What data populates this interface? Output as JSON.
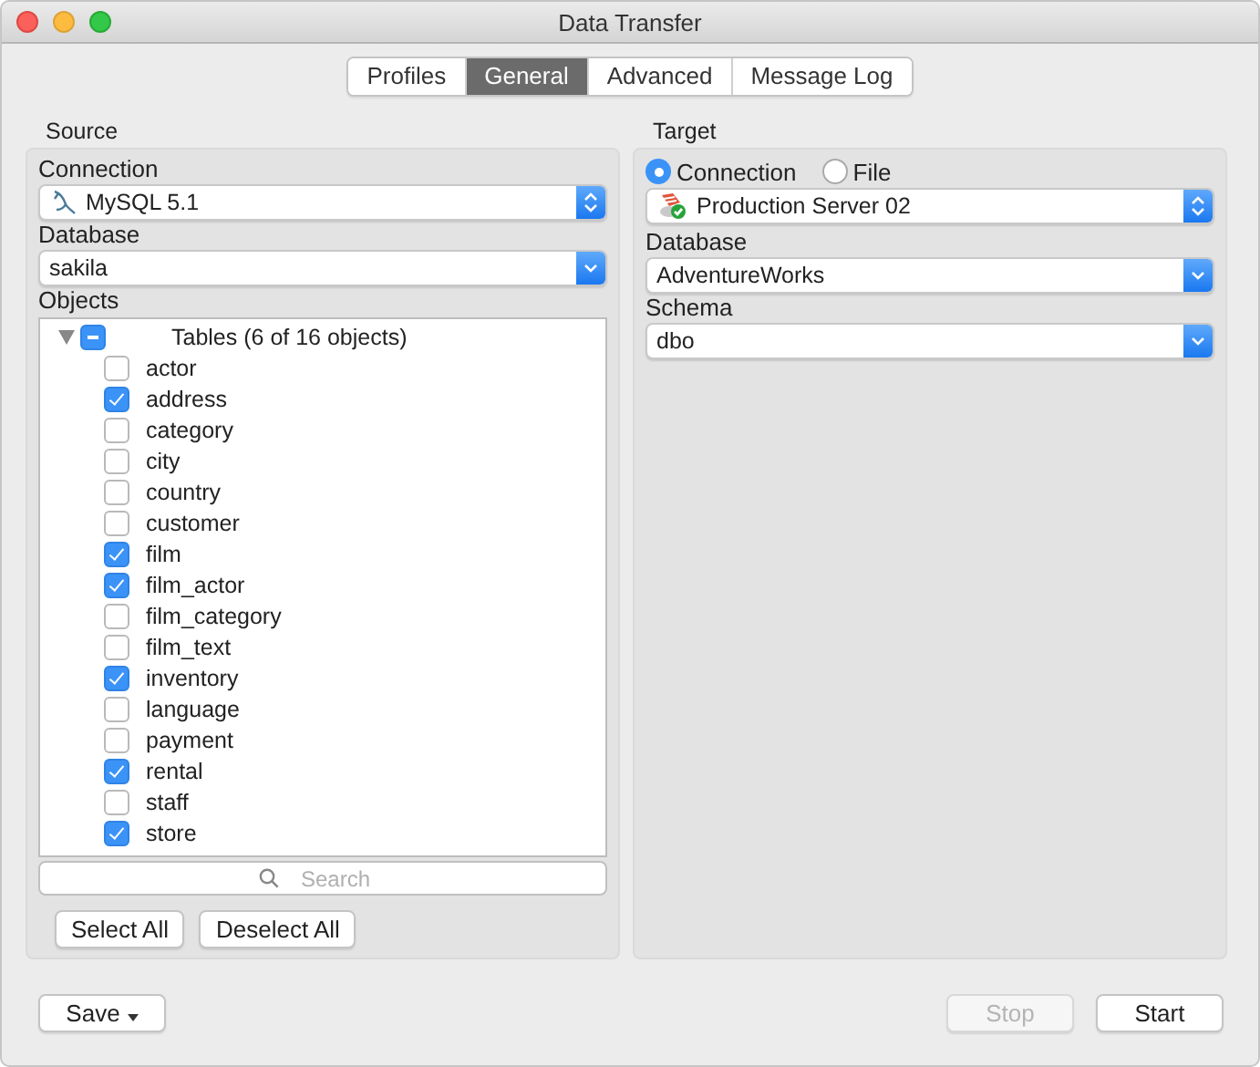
{
  "window": {
    "title": "Data Transfer"
  },
  "tabs": [
    {
      "label": "Profiles",
      "selected": false
    },
    {
      "label": "General",
      "selected": true
    },
    {
      "label": "Advanced",
      "selected": false
    },
    {
      "label": "Message Log",
      "selected": false
    }
  ],
  "source": {
    "heading": "Source",
    "connection_label": "Connection",
    "connection": {
      "value": "MySQL 5.1",
      "kind": "stepper"
    },
    "database_label": "Database",
    "database": {
      "value": "sakila",
      "kind": "dropdown"
    },
    "objects_label": "Objects",
    "tree": {
      "label": "Tables (6 of 16 objects)",
      "expanded": true,
      "mixed": true,
      "children": [
        {
          "label": "actor",
          "checked": false
        },
        {
          "label": "address",
          "checked": true
        },
        {
          "label": "category",
          "checked": false
        },
        {
          "label": "city",
          "checked": false
        },
        {
          "label": "country",
          "checked": false
        },
        {
          "label": "customer",
          "checked": false
        },
        {
          "label": "film",
          "checked": true
        },
        {
          "label": "film_actor",
          "checked": true
        },
        {
          "label": "film_category",
          "checked": false
        },
        {
          "label": "film_text",
          "checked": false
        },
        {
          "label": "inventory",
          "checked": true
        },
        {
          "label": "language",
          "checked": false
        },
        {
          "label": "payment",
          "checked": false
        },
        {
          "label": "rental",
          "checked": true
        },
        {
          "label": "staff",
          "checked": false
        },
        {
          "label": "store",
          "checked": true
        }
      ]
    },
    "search": {
      "placeholder": "Search"
    },
    "buttons": [
      {
        "label": "Select All"
      },
      {
        "label": "Deselect All"
      }
    ]
  },
  "target": {
    "heading": "Target",
    "destination": [
      {
        "label": "Connection",
        "selected": true
      },
      {
        "label": "File",
        "selected": false
      }
    ],
    "connection": {
      "value": "Production Server 02",
      "kind": "stepper"
    },
    "database_label": "Database",
    "database": {
      "value": "AdventureWorks",
      "kind": "dropdown"
    },
    "schema_label": "Schema",
    "schema": {
      "value": "dbo",
      "kind": "dropdown"
    }
  },
  "footer": {
    "save": {
      "label": "Save",
      "menu": true
    },
    "buttons": [
      {
        "label": "Stop",
        "disabled": true
      },
      {
        "label": "Start",
        "disabled": false
      }
    ]
  }
}
